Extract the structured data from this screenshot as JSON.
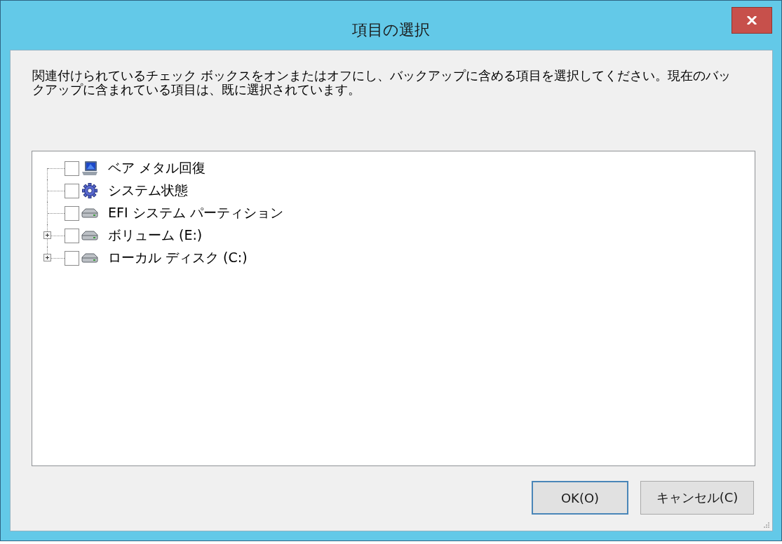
{
  "window": {
    "title": "項目の選択"
  },
  "description": "関連付けられているチェック ボックスをオンまたはオフにし、バックアップに含める項目を選択してください。現在のバックアップに含まれている項目は、既に選択されています。",
  "tree": {
    "items": [
      {
        "label": "ベア メタル回復",
        "kind": "bare-metal",
        "checked": false
      },
      {
        "label": "システム状態",
        "kind": "system-state",
        "checked": false
      },
      {
        "label": "EFI システム パーティション",
        "kind": "drive",
        "checked": false
      },
      {
        "label": "ボリューム (E:)",
        "kind": "drive",
        "checked": false,
        "expanded": false
      },
      {
        "label": "ローカル ディスク (C:)",
        "kind": "drive",
        "checked": false,
        "expanded": false
      }
    ]
  },
  "buttons": [
    {
      "label": "OK(O)",
      "default": true
    },
    {
      "label": "キャンセル(C)",
      "default": false
    }
  ]
}
